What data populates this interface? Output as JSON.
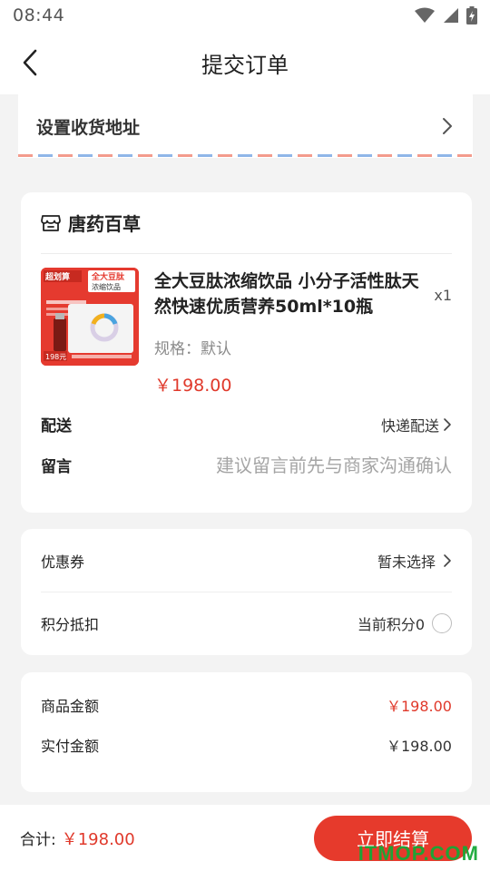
{
  "status_bar": {
    "time": "08:44"
  },
  "header": {
    "title": "提交订单"
  },
  "address": {
    "label": "设置收货地址"
  },
  "shop": {
    "name": "唐药百草",
    "product": {
      "title": "全大豆肽浓缩饮品 小分子活性肽天然快速优质营养50ml*10瓶",
      "quantity": "x1",
      "spec": "规格：默认",
      "price": "￥198.00",
      "thumb_text": {
        "top_left": "超划算",
        "brand": "全大豆肽",
        "subtitle": "浓缩饮品",
        "price_tag": "198元"
      }
    },
    "delivery": {
      "label": "配送",
      "value": "快递配送"
    },
    "remark": {
      "label": "留言",
      "placeholder": "建议留言前先与商家沟通确认"
    }
  },
  "coupon": {
    "label": "优惠券",
    "value": "暂未选择"
  },
  "points": {
    "label": "积分抵扣",
    "value": "当前积分0"
  },
  "amounts": {
    "goods_label": "商品金额",
    "goods_value": "￥198.00",
    "paid_label": "实付金额",
    "paid_value": "￥198.00"
  },
  "footer": {
    "total_label": "合计:",
    "total_value": "￥198.00",
    "checkout_label": "立即结算"
  },
  "watermark": "ITMOP.COM",
  "colors": {
    "accent": "#e63a2c",
    "price": "#e0392b",
    "watermark": "#17a836"
  }
}
